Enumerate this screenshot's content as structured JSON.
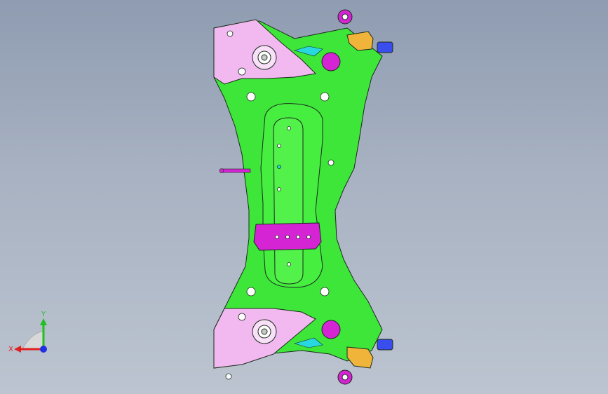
{
  "viewport": {
    "background_top": "#8f9cb1",
    "background_bottom": "#bcc4d0"
  },
  "model": {
    "name_icon": "subframe-model-icon",
    "colors": {
      "body": "#3ee63a",
      "bracket": "#f2b8f0",
      "mount_pad": "#d424d4",
      "tab_yellow": "#f0b43a",
      "tab_blue": "#3a4ef0",
      "edge": "#1a2a1a",
      "accent_cyan": "#28d8e0"
    }
  },
  "triad": {
    "x_label": "X",
    "y_label": "Y",
    "x_color": "#e02020",
    "y_color": "#20c020",
    "z_color": "#2030e0"
  }
}
